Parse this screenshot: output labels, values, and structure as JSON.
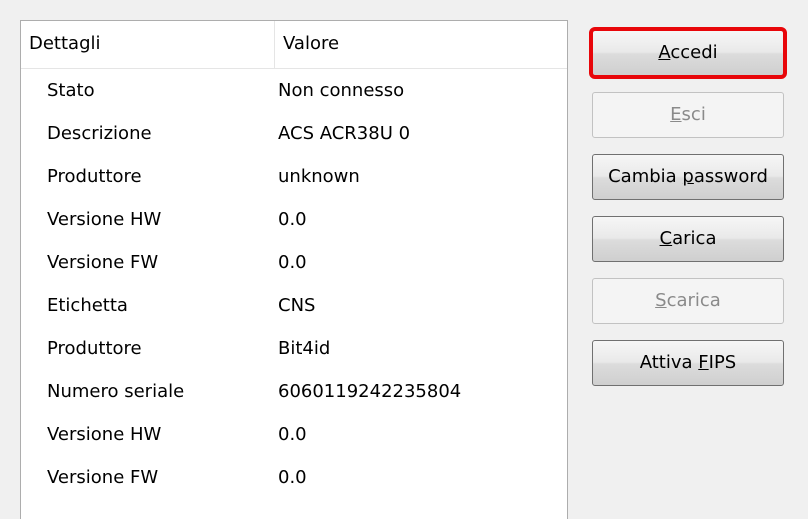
{
  "table": {
    "columns": [
      "Dettagli",
      "Valore"
    ],
    "rows": [
      {
        "key": "Stato",
        "value": "Non connesso"
      },
      {
        "key": "Descrizione",
        "value": "ACS ACR38U 0"
      },
      {
        "key": "Produttore",
        "value": "unknown"
      },
      {
        "key": "Versione HW",
        "value": "0.0"
      },
      {
        "key": "Versione FW",
        "value": "0.0"
      },
      {
        "key": "Etichetta",
        "value": "CNS"
      },
      {
        "key": "Produttore",
        "value": "Bit4id"
      },
      {
        "key": "Numero seriale",
        "value": "6060119242235804"
      },
      {
        "key": "Versione HW",
        "value": "0.0"
      },
      {
        "key": "Versione FW",
        "value": "0.0"
      }
    ]
  },
  "buttons": {
    "accedi": {
      "pre": "",
      "mnemonic": "A",
      "post": "ccedi",
      "enabled": true,
      "highlighted": true
    },
    "esci": {
      "pre": "",
      "mnemonic": "E",
      "post": "sci",
      "enabled": false
    },
    "cambia_password": {
      "pre": "Cambia ",
      "mnemonic": "p",
      "post": "assword",
      "enabled": true
    },
    "carica": {
      "pre": "",
      "mnemonic": "C",
      "post": "arica",
      "enabled": true
    },
    "scarica": {
      "pre": "",
      "mnemonic": "S",
      "post": "carica",
      "enabled": false
    },
    "attiva_fips": {
      "pre": "Attiva ",
      "mnemonic": "F",
      "post": "IPS",
      "enabled": true
    }
  },
  "colors": {
    "highlight_border": "#e8060a",
    "disabled_text": "#8a8a8a"
  }
}
